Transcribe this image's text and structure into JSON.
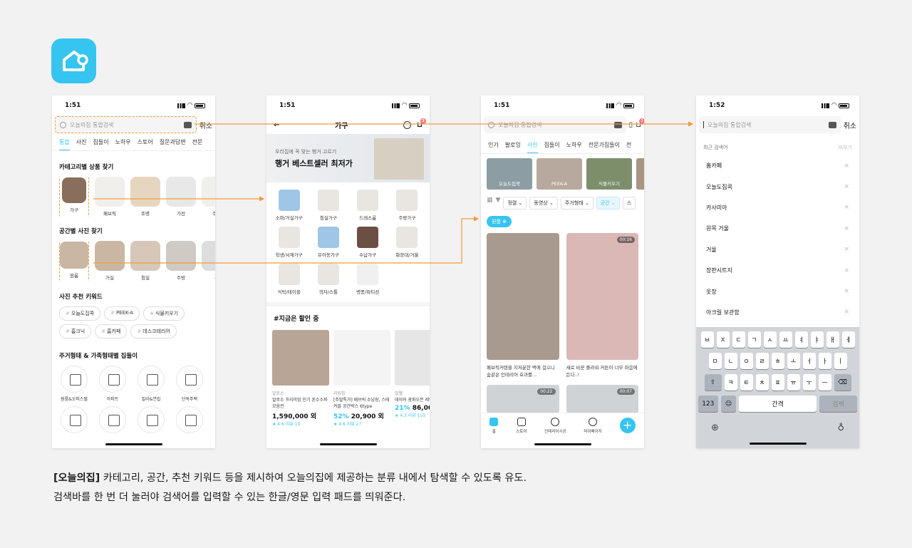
{
  "colors": {
    "accent": "#35c5f0",
    "annotation": "#f39a3c"
  },
  "logo_icon": "ohouse-house-icon",
  "screen1": {
    "time": "1:51",
    "search_placeholder": "오늘의집 통합검색",
    "cancel": "취소",
    "tabs": [
      "통합",
      "사진",
      "집들이",
      "노하우",
      "스토어",
      "질문과답변",
      "전문"
    ],
    "section_category": "카테고리별 상품 찾기",
    "categories": [
      "가구",
      "패브릭",
      "조명",
      "가전",
      "주방"
    ],
    "section_space": "공간별 사진 찾기",
    "spaces": [
      "원룸",
      "거실",
      "침실",
      "주방",
      "욕"
    ],
    "section_keywords": "사진 추천 키워드",
    "keywords": [
      "오늘도집콕",
      "PEEK-A",
      "식물키우기",
      "홈크닉",
      "홈카페",
      "데스크테리어"
    ],
    "section_house": "주거형태 & 가족형태별 집들이",
    "house_types": [
      "원룸&오피스텔",
      "아파트",
      "빌라&연립",
      "단독주택"
    ]
  },
  "screen2": {
    "time": "1:51",
    "title": "가구",
    "cart_count": "3",
    "banner_sub": "우리집에 꼭 맞는 행거 고르기",
    "banner_title": "행거 베스트셀러 최저가",
    "items": [
      "소파/거실가구",
      "침실가구",
      "드레스룸",
      "주방가구",
      "학생/서재가구",
      "유아동가구",
      "수납가구",
      "화장대/거울",
      "식탁/테이블",
      "의자/스툴",
      "병풍/파티션"
    ],
    "deal_title": "#지금은 할인 중",
    "products": [
      {
        "brand": "알로소",
        "name": "알로소 프리미엄 인기 혼수소파 모음전",
        "price": "1,590,000 외",
        "rating": "★ 4.6 리뷰 19"
      },
      {
        "brand": "리빙집",
        "name": "[주말특가] 패브릭 수납장, 스태커블 공간박스 6type",
        "discount": "52%",
        "price": "20,900 외",
        "rating": "★ 4.6 리뷰 27"
      },
      {
        "brand": "밀웰",
        "name": "데이와 광파오븐 레인지대 13종",
        "discount": "21%",
        "price": "86,00",
        "rating": "★ 4.3 리뷰 155"
      }
    ]
  },
  "screen3": {
    "time": "1:51",
    "search_placeholder": "오늘의집 통합검색",
    "cart_count": "3",
    "tabs": [
      "인기",
      "팔로잉",
      "사진",
      "집들이",
      "노하우",
      "전문가집들이",
      "전"
    ],
    "thumbs": [
      "오늘도집콕",
      "PEEK-A",
      "식물키우기"
    ],
    "filters": [
      "정렬",
      "동영상",
      "주거형태",
      "공간",
      "스"
    ],
    "active_pill": "원룸",
    "photos": [
      {
        "caption": "패브릭커텐을 지저분한 벽에 걸으니 숨같은 인테리어 효과를..."
      },
      {
        "caption": "새로 비꾼 플라워 커튼이 너무 마음에 든다..!",
        "duration": "00:16"
      },
      {
        "duration": "00:22"
      },
      {
        "duration": "00:07"
      }
    ],
    "nav": [
      "홈",
      "스토어",
      "인테리어시공",
      "마이페이지"
    ]
  },
  "screen4": {
    "time": "1:52",
    "search_placeholder": "오늘의집 통합검색",
    "cancel": "취소",
    "recent_label": "최근 검색어",
    "delete_all": "비우기",
    "recent": [
      "홈카페",
      "오늘도집콕",
      "카사미아",
      "원목 거울",
      "거울",
      "장판시트지",
      "옷장",
      "아크릴 보관함"
    ],
    "kb_row1": [
      "ㅂ",
      "ㅈ",
      "ㄷ",
      "ㄱ",
      "ㅅ",
      "ㅛ",
      "ㅕ",
      "ㅑ",
      "ㅐ",
      "ㅔ"
    ],
    "kb_row2": [
      "ㅁ",
      "ㄴ",
      "ㅇ",
      "ㄹ",
      "ㅎ",
      "ㅗ",
      "ㅓ",
      "ㅏ",
      "ㅣ"
    ],
    "kb_row3": [
      "ㅋ",
      "ㅌ",
      "ㅊ",
      "ㅍ",
      "ㅠ",
      "ㅜ",
      "ㅡ"
    ],
    "kb_num": "123",
    "kb_space": "간격",
    "kb_search": "검색"
  },
  "caption": {
    "brand": "[오늘의집]",
    "line1": " 카테고리, 공간, 추천 키워드 등을 제시하여 오늘의집에 제공하는 분류 내에서 탐색할 수 있도록 유도.",
    "line2": "검색바를 한 번 더 눌러야 검색어를 입력할 수 있는 한글/영문 입력 패드를 띄워준다."
  }
}
